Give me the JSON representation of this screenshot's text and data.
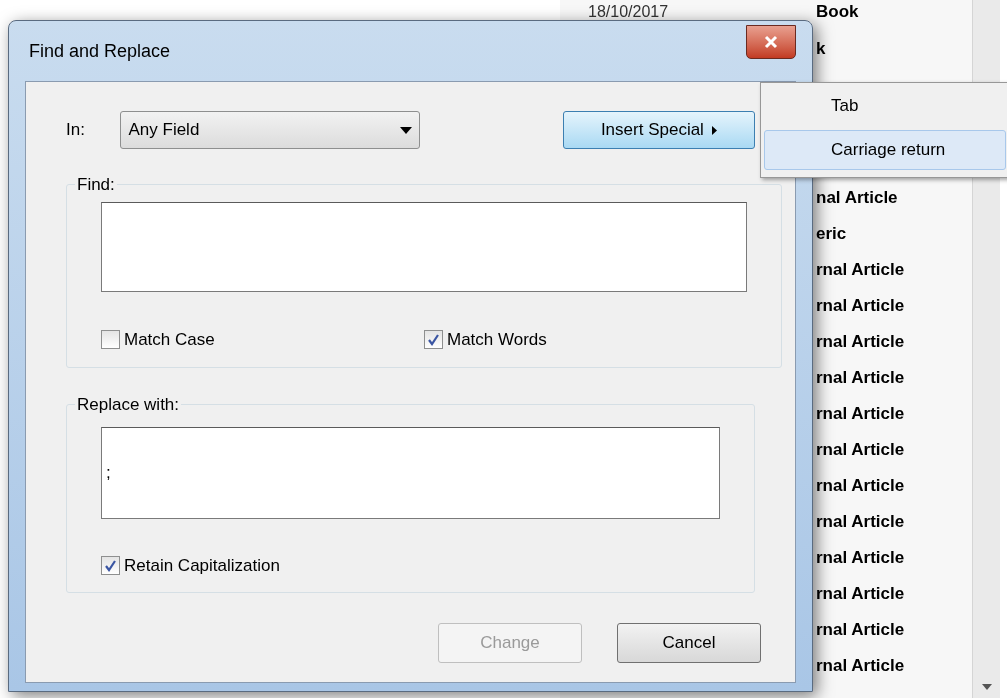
{
  "background_list": {
    "rows": [
      {
        "date": "18/10/2017",
        "type": "Book"
      },
      {
        "type": "k"
      },
      {
        "type": "nal Article"
      },
      {
        "type": "eric"
      },
      {
        "type": "rnal Article"
      },
      {
        "type": "rnal Article"
      },
      {
        "type": "rnal Article"
      },
      {
        "type": "rnal Article"
      },
      {
        "type": "rnal Article"
      },
      {
        "type": "rnal Article"
      },
      {
        "type": "rnal Article"
      },
      {
        "type": "rnal Article"
      },
      {
        "type": "rnal Article"
      },
      {
        "type": "rnal Article"
      },
      {
        "type": "rnal Article"
      },
      {
        "type": "rnal Article"
      }
    ]
  },
  "window": {
    "title": "Find and Replace"
  },
  "in_field": {
    "label": "In:",
    "value": "Any Field"
  },
  "insert_special": {
    "label": "Insert Special"
  },
  "find": {
    "label": "Find:"
  },
  "find_options": [
    {
      "label": "Match Case",
      "checked": false
    },
    {
      "label": "Match Words",
      "checked": true
    }
  ],
  "replace": {
    "label": "Replace with:",
    "value": ";"
  },
  "replace_options": [
    {
      "label": "Retain Capitalization",
      "checked": true
    }
  ],
  "buttons": [
    {
      "label": "Change",
      "disabled": true
    },
    {
      "label": "Cancel",
      "disabled": false
    }
  ],
  "menu": {
    "items": [
      {
        "label": "Tab",
        "selected": false
      },
      {
        "label": "Carriage return",
        "selected": true
      }
    ]
  }
}
